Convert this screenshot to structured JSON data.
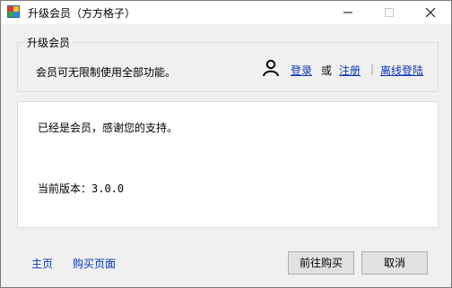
{
  "window": {
    "title": "升级会员（方方格子）"
  },
  "group": {
    "legend": "升级会员",
    "description": "会员可无限制使用全部功能。",
    "login_label": "登录",
    "or_label": "或",
    "register_label": "注册",
    "separator": "|",
    "offline_login_label": "离线登陆"
  },
  "panel": {
    "thanks_text": "已经是会员，感谢您的支持。",
    "version_text": "当前版本：3.0.0"
  },
  "footer": {
    "home_label": "主页",
    "buy_page_label": "购买页面",
    "go_buy_label": "前往购买",
    "cancel_label": "取消"
  }
}
